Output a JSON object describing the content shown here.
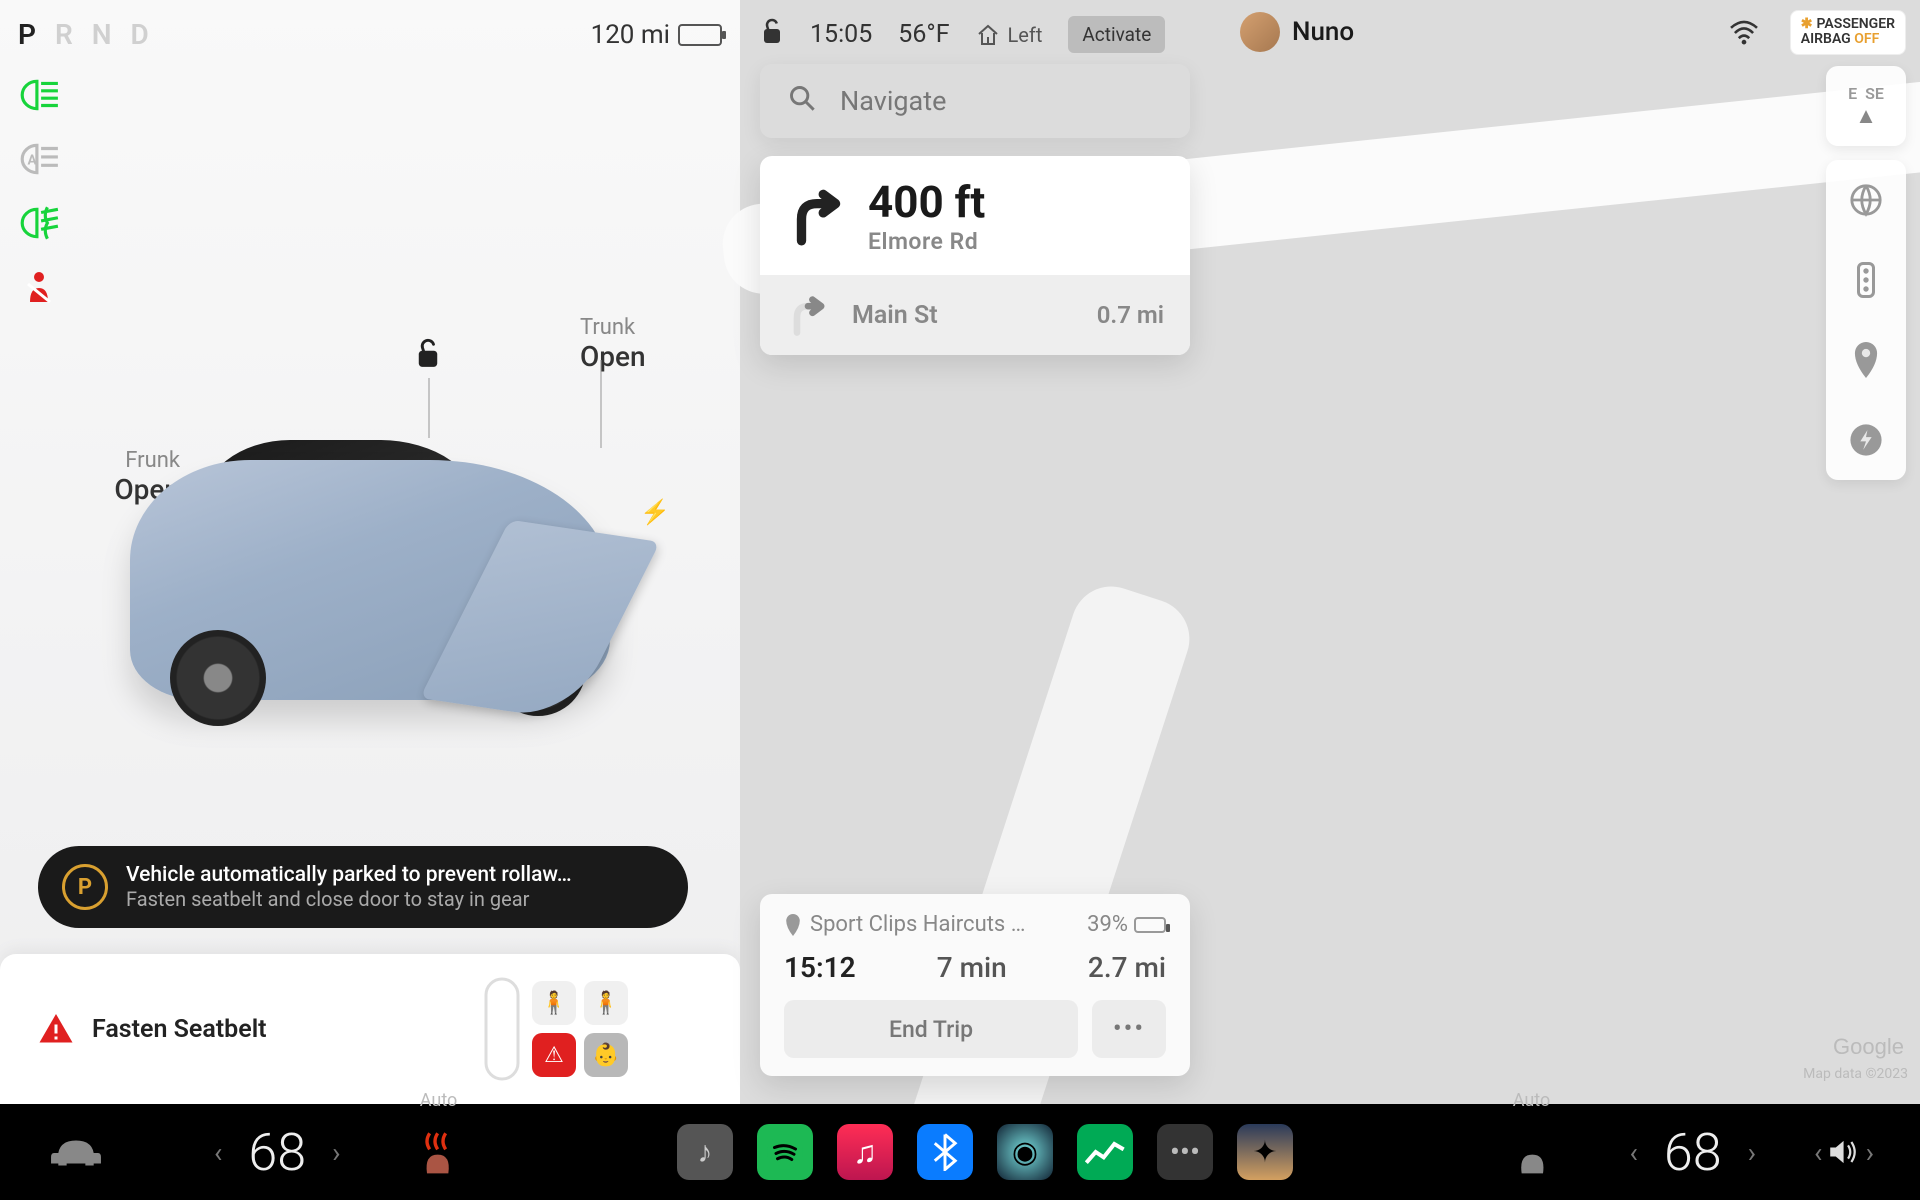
{
  "prnd": {
    "p": "P",
    "r": "R",
    "n": "N",
    "d": "D",
    "active": "P"
  },
  "range": "120 mi",
  "frunk": {
    "label": "Frunk",
    "state": "Open"
  },
  "trunk": {
    "label": "Trunk",
    "state": "Open"
  },
  "alert": {
    "title": "Vehicle automatically parked to prevent rollaw…",
    "sub": "Fasten seatbelt and close door to stay in gear"
  },
  "seatbelt_warning": "Fasten Seatbelt",
  "status": {
    "time": "15:05",
    "temp": "56°F",
    "home": "Left",
    "activate": "Activate"
  },
  "profile": {
    "name": "Nuno"
  },
  "airbag": {
    "line1": "PASSENGER",
    "line2": "AIRBAG",
    "state": "OFF"
  },
  "search_placeholder": "Navigate",
  "nav": {
    "primary": {
      "distance": "400 ft",
      "road": "Elmore Rd"
    },
    "secondary": {
      "road": "Main St",
      "distance": "0.7 mi"
    }
  },
  "compass": {
    "e": "E",
    "se": "SE"
  },
  "destination": {
    "name": "Sport Clips Haircuts …",
    "battery": "39%",
    "arrival": "15:12",
    "duration": "7 min",
    "distance": "2.7 mi",
    "end_trip": "End Trip"
  },
  "attribution": {
    "brand": "Google",
    "data": "Map data ©2023"
  },
  "climate": {
    "left_temp": "68",
    "right_temp": "68",
    "auto": "Auto"
  }
}
